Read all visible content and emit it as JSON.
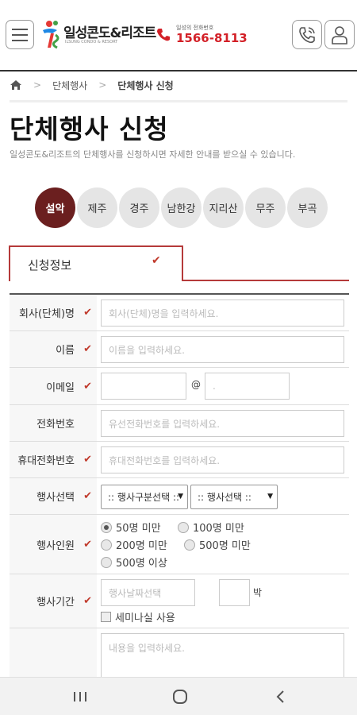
{
  "header": {
    "menu_icon": "hamburger-icon",
    "logo_text": "일성콘도&리조트",
    "logo_sub": "ILSUNG CONDO & RESORT",
    "phone_caption": "일성의 전화번호",
    "phone_number": "1566-8113",
    "call_icon": "phone-call-icon",
    "user_icon": "user-icon"
  },
  "breadcrumb": {
    "home_icon": "home-icon",
    "items": [
      "단체행사",
      "단체행사 신청"
    ]
  },
  "page": {
    "title": "단체행사 신청",
    "description": "일성콘도&리조트의 단체행사를 신청하시면 자세한 안내를 받으실 수 있습니다."
  },
  "locations": [
    {
      "label": "설악",
      "active": true
    },
    {
      "label": "제주",
      "active": false
    },
    {
      "label": "경주",
      "active": false
    },
    {
      "label": "남한강",
      "active": false
    },
    {
      "label": "지리산",
      "active": false
    },
    {
      "label": "무주",
      "active": false
    },
    {
      "label": "부곡",
      "active": false
    }
  ],
  "tab": {
    "label": "신청정보",
    "check_icon": "check-icon"
  },
  "form": {
    "company": {
      "label": "회사(단체)명",
      "placeholder": "회사(단체)명을 입력하세요."
    },
    "name": {
      "label": "이름",
      "placeholder": "이름을 입력하세요."
    },
    "email": {
      "label": "이메일",
      "at": "@",
      "domain_placeholder": "."
    },
    "phone": {
      "label": "전화번호",
      "placeholder": "유선전화번호를 입력하세요."
    },
    "mobile": {
      "label": "휴대전화번호",
      "placeholder": "휴대전화번호를 입력하세요."
    },
    "event_select": {
      "label": "행사선택",
      "type_value": ":: 행사구분선택 ::",
      "event_value": ":: 행사선택 ::"
    },
    "attendees": {
      "label": "행사인원",
      "options": [
        "50명 미만",
        "100명 미만",
        "200명 미만",
        "500명 미만",
        "500명 이상"
      ],
      "selected": "50명 미만"
    },
    "period": {
      "label": "행사기간",
      "date_placeholder": "행사날짜선택",
      "nights_unit": "박",
      "seminar_label": "세미나실 사용"
    },
    "content": {
      "placeholder": "내용을 입력하세요."
    }
  },
  "colors": {
    "accent": "#6b1f1f",
    "tab_border": "#b53a3a",
    "required": "#c0392b",
    "phone": "#d32027"
  },
  "navbar": {
    "recent_icon": "recent-apps-icon",
    "home_icon": "home-circle-icon",
    "back_icon": "back-icon"
  }
}
